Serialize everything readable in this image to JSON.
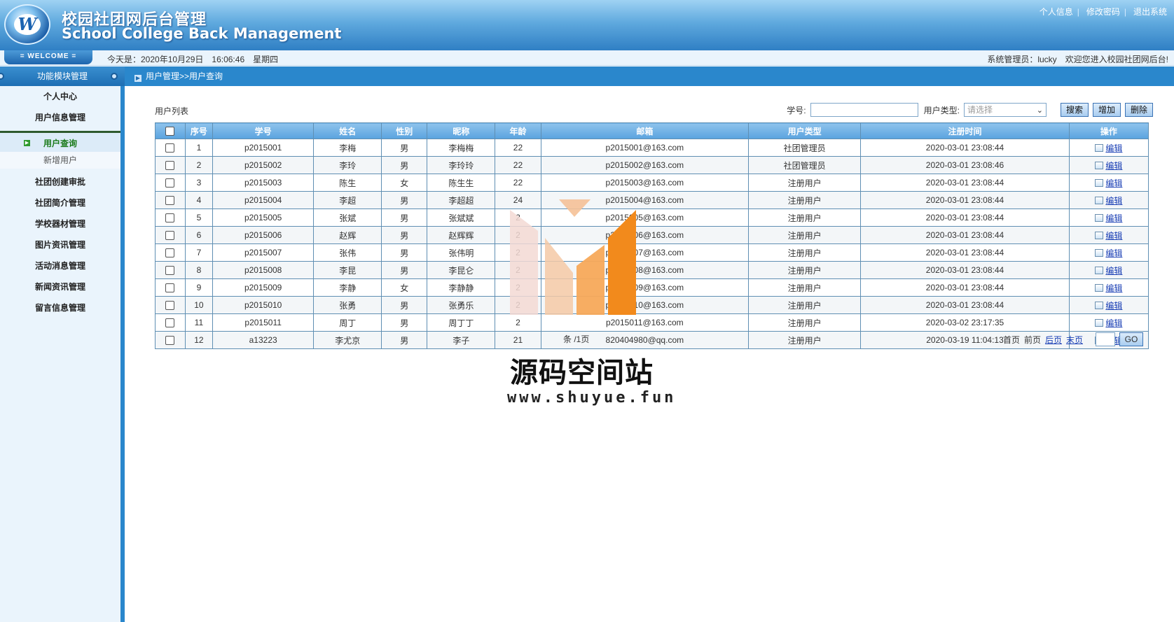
{
  "header": {
    "title_cn": "校园社团网后台管理",
    "title_en": "School College Back Management",
    "links": [
      "个人信息",
      "修改密码",
      "退出系统"
    ]
  },
  "welcome": {
    "badge": "= WELCOME =",
    "date_label": "今天是：2020年10月29日",
    "time": "16:06:46",
    "weekday": "星期四",
    "admin_label": "系统管理员：lucky",
    "welcome_msg": "欢迎您进入校园社团网后台!"
  },
  "sidebar": {
    "header": "功能模块管理",
    "items": [
      {
        "label": "个人中心"
      },
      {
        "label": "用户信息管理"
      },
      {
        "label": "用户查询",
        "active": true
      },
      {
        "label": "新增用户",
        "sub": true
      },
      {
        "label": "社团创建审批"
      },
      {
        "label": "社团简介管理"
      },
      {
        "label": "学校器材管理"
      },
      {
        "label": "图片资讯管理"
      },
      {
        "label": "活动消息管理"
      },
      {
        "label": "新闻资讯管理"
      },
      {
        "label": "留言信息管理"
      }
    ]
  },
  "breadcrumb": "用户管理>>用户查询",
  "main": {
    "list_title": "用户列表",
    "search": {
      "student_no_label": "学号:",
      "student_no_value": "",
      "type_label": "用户类型:",
      "type_selected": "请选择",
      "search_btn": "搜索",
      "add_btn": "增加",
      "delete_btn": "删除"
    },
    "table": {
      "headers": [
        "序号",
        "学号",
        "姓名",
        "性别",
        "昵称",
        "年龄",
        "邮箱",
        "用户类型",
        "注册时间",
        "操作"
      ],
      "edit_label": "编辑",
      "rows": [
        [
          "1",
          "p2015001",
          "李梅",
          "男",
          "李梅梅",
          "22",
          "p2015001@163.com",
          "社团管理员",
          "2020-03-01 23:08:44"
        ],
        [
          "2",
          "p2015002",
          "李玲",
          "男",
          "李玲玲",
          "22",
          "p2015002@163.com",
          "社团管理员",
          "2020-03-01 23:08:46"
        ],
        [
          "3",
          "p2015003",
          "陈生",
          "女",
          "陈生生",
          "22",
          "p2015003@163.com",
          "注册用户",
          "2020-03-01 23:08:44"
        ],
        [
          "4",
          "p2015004",
          "李超",
          "男",
          "李超超",
          "24",
          "p2015004@163.com",
          "注册用户",
          "2020-03-01 23:08:44"
        ],
        [
          "5",
          "p2015005",
          "张斌",
          "男",
          "张斌斌",
          "2",
          "p2015005@163.com",
          "注册用户",
          "2020-03-01 23:08:44"
        ],
        [
          "6",
          "p2015006",
          "赵辉",
          "男",
          "赵辉辉",
          "2",
          "p2015006@163.com",
          "注册用户",
          "2020-03-01 23:08:44"
        ],
        [
          "7",
          "p2015007",
          "张伟",
          "男",
          "张伟明",
          "2",
          "p2015007@163.com",
          "注册用户",
          "2020-03-01 23:08:44"
        ],
        [
          "8",
          "p2015008",
          "李昆",
          "男",
          "李昆仑",
          "2",
          "p2015008@163.com",
          "注册用户",
          "2020-03-01 23:08:44"
        ],
        [
          "9",
          "p2015009",
          "李静",
          "女",
          "李静静",
          "2",
          "p2015009@163.com",
          "注册用户",
          "2020-03-01 23:08:44"
        ],
        [
          "10",
          "p2015010",
          "张勇",
          "男",
          "张勇乐",
          "2",
          "p2015010@163.com",
          "注册用户",
          "2020-03-01 23:08:44"
        ],
        [
          "11",
          "p2015011",
          "周丁",
          "男",
          "周丁丁",
          "2",
          "p2015011@163.com",
          "注册用户",
          "2020-03-02 23:17:35"
        ],
        [
          "12",
          "a13223",
          "李尤京",
          "男",
          "李子",
          "21",
          "820404980@qq.com",
          "注册用户",
          "2020-03-19 11:04:13"
        ]
      ]
    },
    "pager": {
      "summary": "条 /1页",
      "first": "首页",
      "prev": "前页",
      "next": "后页",
      "last": "末页",
      "go": "GO"
    }
  },
  "watermark": {
    "cn": "源码空间站",
    "url": "www.shuyue.fun"
  }
}
